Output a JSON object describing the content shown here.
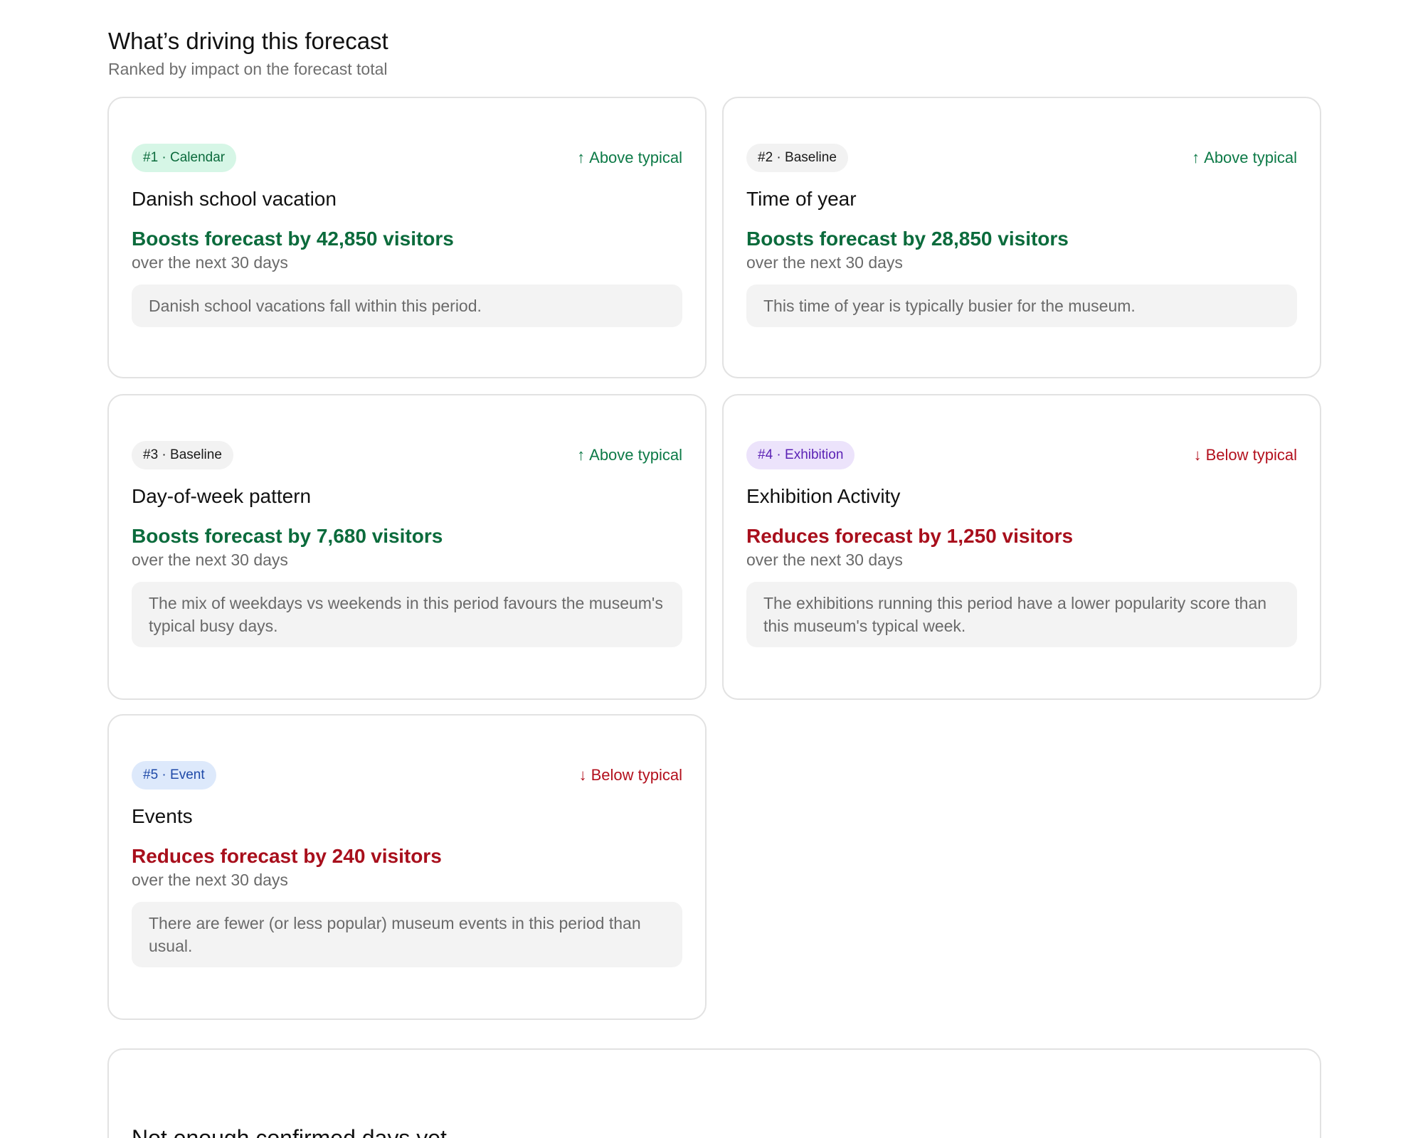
{
  "header": {
    "title": "What’s driving this forecast",
    "subtitle": "Ranked by impact on the forecast total"
  },
  "colors": {
    "positive": "#0b6b3c",
    "negative": "#a80f1c",
    "badge_calendar": "#d6f6e6",
    "badge_baseline": "#f2f2f2",
    "badge_exhibition": "#ece3fb",
    "badge_event": "#dde9fb"
  },
  "drivers": [
    {
      "badge": "#1 · Calendar",
      "trend_icon": "arrow-up-icon",
      "trend_arrow": "↑",
      "trend": "Above typical",
      "title": "Danish school vacation",
      "impact": "Boosts forecast by 42,850 visitors",
      "period": "over the next 30 days",
      "note": "Danish school vacations fall within this period."
    },
    {
      "badge": "#2 · Baseline",
      "trend_icon": "arrow-up-icon",
      "trend_arrow": "↑",
      "trend": "Above typical",
      "title": "Time of year",
      "impact": "Boosts forecast by 28,850 visitors",
      "period": "over the next 30 days",
      "note": "This time of year is typically busier for the museum."
    },
    {
      "badge": "#3 · Baseline",
      "trend_icon": "arrow-up-icon",
      "trend_arrow": "↑",
      "trend": "Above typical",
      "title": "Day-of-week pattern",
      "impact": "Boosts forecast by 7,680 visitors",
      "period": "over the next 30 days",
      "note": "The mix of weekdays vs weekends in this period favours the museum's typical busy days."
    },
    {
      "badge": "#4 · Exhibition",
      "trend_icon": "arrow-down-icon",
      "trend_arrow": "↓",
      "trend": "Below typical",
      "title": "Exhibition Activity",
      "impact": "Reduces forecast by 1,250 visitors",
      "period": "over the next 30 days",
      "note": "The exhibitions running this period have a lower popularity score than this museum's typical week."
    },
    {
      "badge": "#5 · Event",
      "trend_icon": "arrow-down-icon",
      "trend_arrow": "↓",
      "trend": "Below typical",
      "title": "Events",
      "impact": "Reduces forecast by 240 visitors",
      "period": "over the next 30 days",
      "note": "There are fewer (or less popular) museum events in this period than usual."
    }
  ],
  "status_card": {
    "title": "Not enough confirmed days yet"
  }
}
